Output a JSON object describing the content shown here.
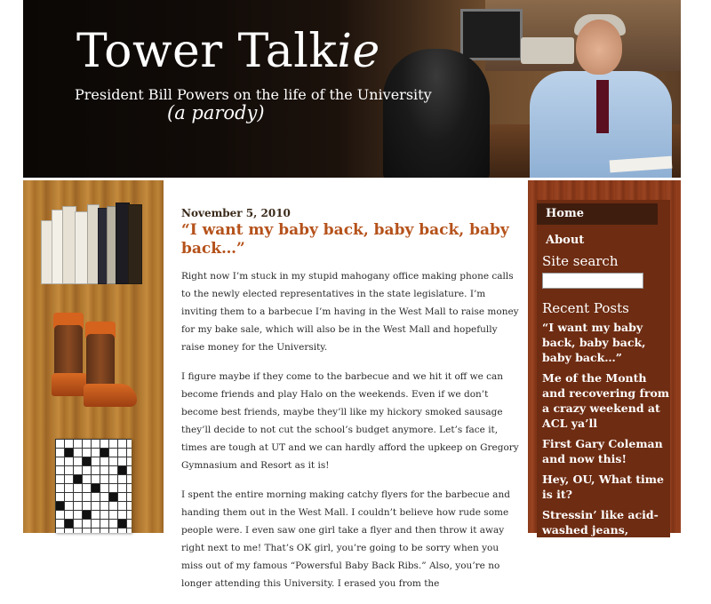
{
  "header": {
    "title_main": "Tower Talk",
    "title_suffix": "ie",
    "subtitle": "President Bill Powers on the life of the University",
    "parody": "(a parody)"
  },
  "post": {
    "date": "November 5, 2010",
    "title": "“I want my baby back, baby back, baby back…”",
    "paragraphs": [
      "Right now I’m stuck in my stupid mahogany office making phone calls to the newly elected representatives in the state legislature. I’m inviting them to a barbecue I’m having in the West Mall to raise money for my bake sale, which will also be in the West Mall and hopefully raise money for the University.",
      "I figure maybe if they come to the barbecue and we hit it off we can become friends and play Halo on the weekends. Even if we don’t become best friends, maybe they’ll like my hickory smoked sausage they’ll decide to not cut the school’s budget anymore. Let’s face it, times are tough at UT and we can hardly afford the upkeep on Gregory Gymnasium and Resort as it is!",
      "I spent the entire morning making catchy flyers for the barbecue and handing them out in the West Mall. I couldn’t believe how rude some people were. I even saw one girl take a flyer and then throw it away right next to me! That’s OK girl, you’re going to be sorry when you miss out of my famous “Powersful Baby Back Ribs.” Also, you’re no longer attending this University. I erased you from the"
    ]
  },
  "sidebar": {
    "nav_home": "Home",
    "nav_about": "About",
    "search_heading": "Site search",
    "search_value": "",
    "recent_heading": "Recent Posts",
    "recent_posts": [
      "“I want my baby back, baby back, baby back…”",
      "Me of the Month and recovering from a crazy weekend at ACL ya’ll",
      "First Gary Coleman and now this!",
      "Hey, OU, What time is it?",
      "Stressin’ like acid-washed jeans,"
    ]
  },
  "decor": {
    "left_panel_icons": [
      "books-icon",
      "cowboy-boots-icon",
      "crossword-icon"
    ],
    "colors": {
      "accent_orange": "#b5521b",
      "sidebar_brown": "#6e2c12",
      "nav_active_bg": "#3f1d0e"
    }
  }
}
